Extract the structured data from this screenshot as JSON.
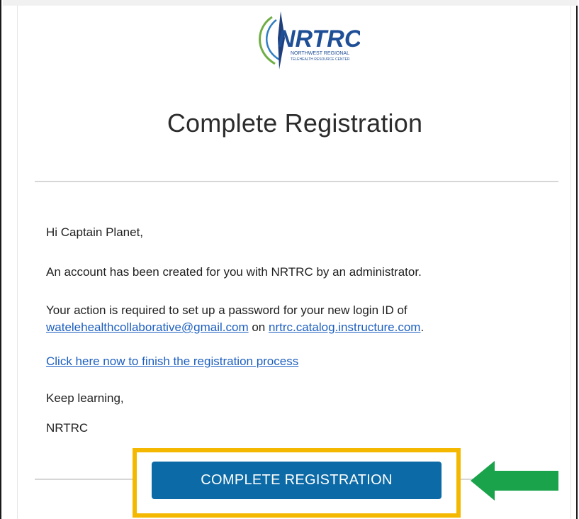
{
  "email": {
    "logo": {
      "name": "NRTRC",
      "tagline_line1": "NORTHWEST REGIONAL",
      "tagline_line2": "TELEHEALTH RESOURCE CENTER"
    },
    "heading": "Complete Registration",
    "greeting": "Hi Captain Planet,",
    "account_line": "An account has been created for you with NRTRC by an administrator.",
    "action_line_part1": "Your action is required to set up a password for your new login ID of",
    "email_link": "watelehealthcollaborative@gmail.com",
    "connector_on": " on ",
    "domain_link": "nrtrc.catalog.instructure.com",
    "period": ".",
    "finish_link": "Click here now to finish the registration process",
    "signoff": "Keep learning,",
    "signature": "NRTRC",
    "cta_label": "COMPLETE REGISTRATION"
  },
  "colors": {
    "button": "#0c6aa6",
    "highlight": "#f5b800",
    "arrow": "#1aa34a",
    "link": "#1d5fbf"
  }
}
